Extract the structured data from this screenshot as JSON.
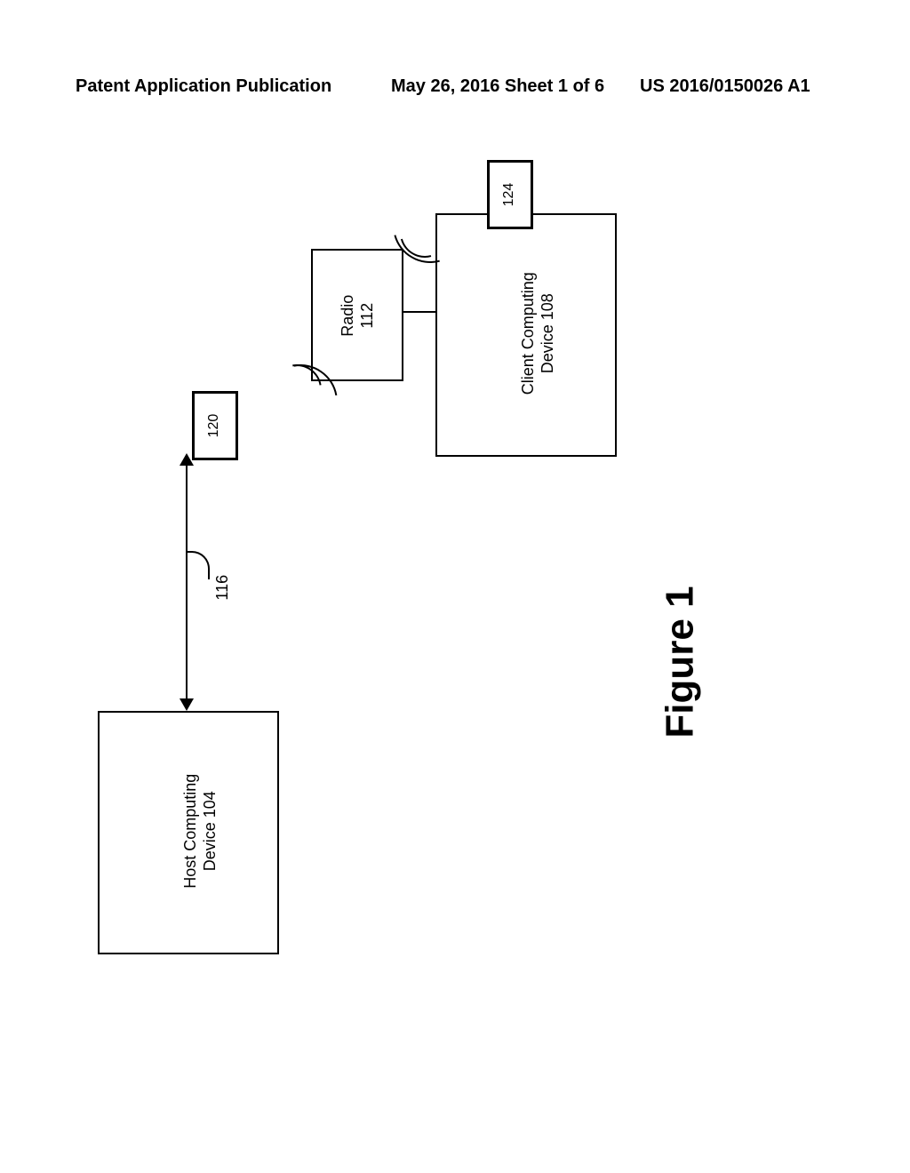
{
  "header": {
    "left": "Patent Application Publication",
    "mid": "May 26, 2016  Sheet 1 of 6",
    "right": "US 2016/0150026 A1"
  },
  "figure": {
    "caption": "Figure 1",
    "host_box": {
      "line1": "Host Computing",
      "line2": "Device 104"
    },
    "client_box": {
      "line1": "Client Computing",
      "line2": "Device 108"
    },
    "radio_box": {
      "line1": "Radio",
      "line2": "112"
    },
    "ref_116": "116",
    "ref_120": "120",
    "ref_124": "124"
  },
  "chart_data": {
    "type": "diagram",
    "nodes": [
      {
        "id": "104",
        "label": "Host Computing Device 104"
      },
      {
        "id": "108",
        "label": "Client Computing Device 108"
      },
      {
        "id": "112",
        "label": "Radio 112"
      },
      {
        "id": "120",
        "label": "120",
        "kind": "wireless-peer"
      },
      {
        "id": "124",
        "label": "124",
        "kind": "wireless-peer"
      }
    ],
    "edges": [
      {
        "from": "104",
        "to": "108",
        "label": "116",
        "style": "bidirectional"
      },
      {
        "from": "108",
        "to": "112",
        "style": "stub"
      },
      {
        "from": "112",
        "to": "120",
        "style": "wireless"
      },
      {
        "from": "112",
        "to": "124",
        "style": "wireless"
      }
    ],
    "title": "Figure 1"
  }
}
